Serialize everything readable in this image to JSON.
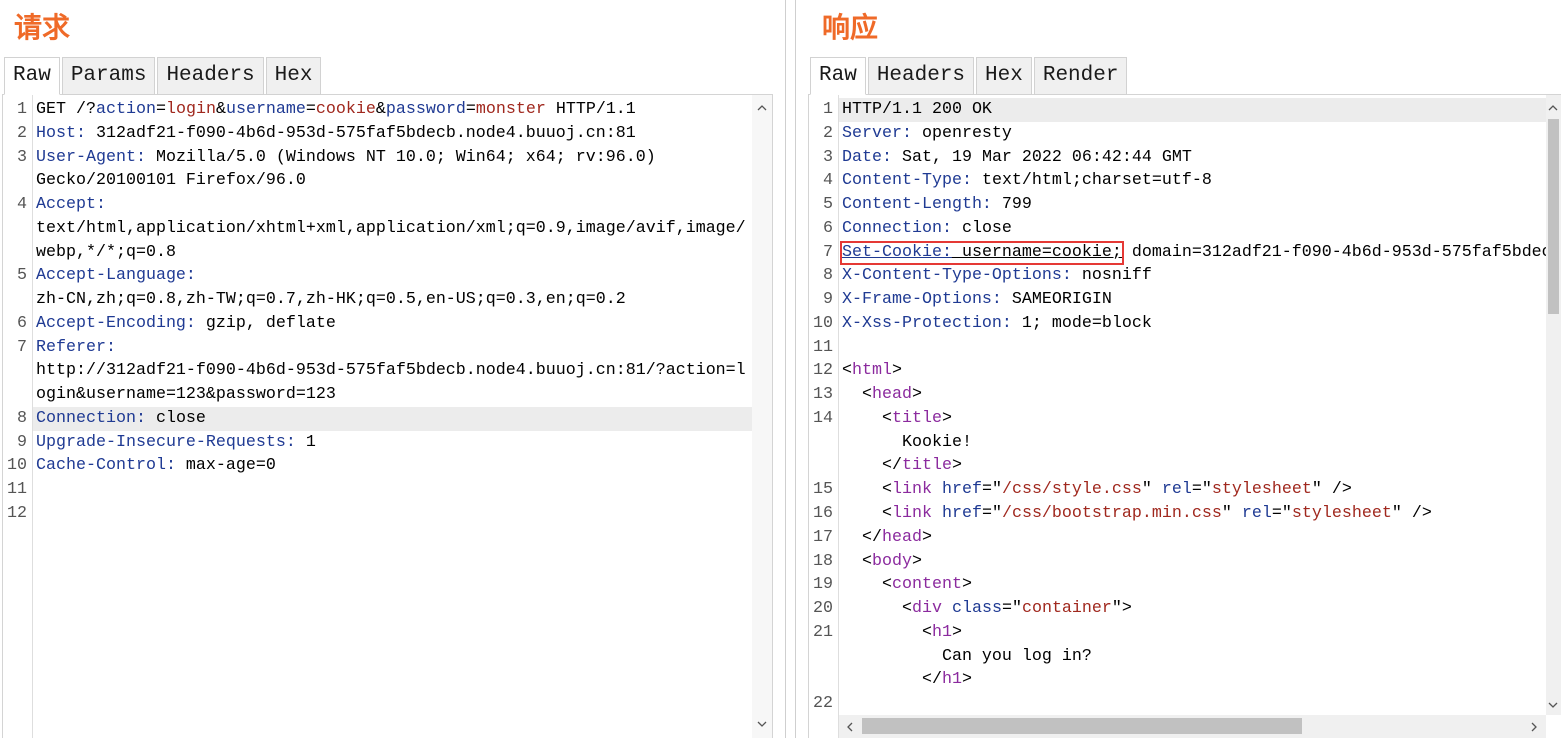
{
  "colors": {
    "accent": "#ef6a28",
    "plain": "#000000",
    "name": "#1f3a93",
    "value": "#a0281e",
    "tag": "#8b2a9e",
    "line_number": "#555555",
    "line_highlight": "#ececec",
    "highlight_box": "#e53935"
  },
  "icons": {
    "scroll_up": "chevron-up-icon",
    "scroll_down": "chevron-down-icon",
    "scroll_left": "chevron-left-icon",
    "scroll_right": "chevron-right-icon"
  },
  "request": {
    "title": "请求",
    "active_tab": "Raw",
    "tabs": [
      {
        "label": "Raw"
      },
      {
        "label": "Params"
      },
      {
        "label": "Headers"
      },
      {
        "label": "Hex"
      }
    ],
    "lines": [
      {
        "n": "1",
        "rows": [
          [
            [
              "GET /?",
              "plain"
            ],
            [
              "action",
              "name"
            ],
            [
              "=",
              "plain"
            ],
            [
              "login",
              "value"
            ],
            [
              "&",
              "plain"
            ],
            [
              "username",
              "name"
            ],
            [
              "=",
              "plain"
            ],
            [
              "cookie",
              "value"
            ],
            [
              "&",
              "plain"
            ],
            [
              "password",
              "name"
            ],
            [
              "=",
              "plain"
            ],
            [
              "monster",
              "value"
            ],
            [
              " HTTP/1.1",
              "plain"
            ]
          ]
        ]
      },
      {
        "n": "2",
        "rows": [
          [
            [
              "Host:",
              "name"
            ],
            [
              " 312adf21-f090-4b6d-953d-575faf5bdecb.node4.buuoj.cn:81",
              "plain"
            ]
          ]
        ]
      },
      {
        "n": "3",
        "rows": [
          [
            [
              "User-Agent:",
              "name"
            ],
            [
              " Mozilla/5.0 (Windows NT 10.0; Win64; x64; rv:96.0)",
              "plain"
            ]
          ],
          [
            [
              "Gecko/20100101 Firefox/96.0",
              "plain"
            ]
          ]
        ]
      },
      {
        "n": "4",
        "rows": [
          [
            [
              "Accept:",
              "name"
            ]
          ],
          [
            [
              "text/html,application/xhtml+xml,application/xml;q=0.9,image/avif,image/",
              "plain"
            ]
          ],
          [
            [
              "webp,*/*;q=0.8",
              "plain"
            ]
          ]
        ]
      },
      {
        "n": "5",
        "rows": [
          [
            [
              "Accept-Language:",
              "name"
            ]
          ],
          [
            [
              "zh-CN,zh;q=0.8,zh-TW;q=0.7,zh-HK;q=0.5,en-US;q=0.3,en;q=0.2",
              "plain"
            ]
          ]
        ]
      },
      {
        "n": "6",
        "rows": [
          [
            [
              "Accept-Encoding:",
              "name"
            ],
            [
              " gzip, deflate",
              "plain"
            ]
          ]
        ]
      },
      {
        "n": "7",
        "rows": [
          [
            [
              "Referer:",
              "name"
            ]
          ],
          [
            [
              "http://312adf21-f090-4b6d-953d-575faf5bdecb.node4.buuoj.cn:81/?action=l",
              "plain"
            ]
          ],
          [
            [
              "ogin&username=123&password=123",
              "plain"
            ]
          ]
        ]
      },
      {
        "n": "8",
        "highlight": true,
        "rows": [
          [
            [
              "Connection:",
              "name"
            ],
            [
              " close",
              "plain"
            ]
          ]
        ]
      },
      {
        "n": "9",
        "rows": [
          [
            [
              "Upgrade-Insecure-Requests:",
              "name"
            ],
            [
              " 1",
              "plain"
            ]
          ]
        ]
      },
      {
        "n": "10",
        "rows": [
          [
            [
              "Cache-Control:",
              "name"
            ],
            [
              " max-age=0",
              "plain"
            ]
          ]
        ]
      },
      {
        "n": "11",
        "rows": [
          []
        ]
      },
      {
        "n": "12",
        "rows": [
          []
        ]
      }
    ]
  },
  "response": {
    "title": "响应",
    "active_tab": "Raw",
    "tabs": [
      {
        "label": "Raw"
      },
      {
        "label": "Headers"
      },
      {
        "label": "Hex"
      },
      {
        "label": "Render"
      }
    ],
    "lines": [
      {
        "n": "1",
        "highlight": true,
        "rows": [
          [
            [
              "HTTP/1.1 200 OK",
              "plain"
            ]
          ]
        ]
      },
      {
        "n": "2",
        "rows": [
          [
            [
              "Server:",
              "name"
            ],
            [
              " openresty",
              "plain"
            ]
          ]
        ]
      },
      {
        "n": "3",
        "rows": [
          [
            [
              "Date:",
              "name"
            ],
            [
              " Sat, 19 Mar 2022 06:42:44 GMT",
              "plain"
            ]
          ]
        ]
      },
      {
        "n": "4",
        "rows": [
          [
            [
              "Content-Type:",
              "name"
            ],
            [
              " text/html;charset=utf-8",
              "plain"
            ]
          ]
        ]
      },
      {
        "n": "5",
        "rows": [
          [
            [
              "Content-Length:",
              "name"
            ],
            [
              " 799",
              "plain"
            ]
          ]
        ]
      },
      {
        "n": "6",
        "rows": [
          [
            [
              "Connection:",
              "name"
            ],
            [
              " close",
              "plain"
            ]
          ]
        ]
      },
      {
        "n": "7",
        "rows": [
          [
            [
              "Set-Cookie:",
              "name",
              "boxed"
            ],
            [
              " username=cookie;",
              "plain",
              "boxed"
            ],
            [
              " domain=312adf21-f090-4b6d-953d-575faf5bdec",
              "plain"
            ]
          ]
        ]
      },
      {
        "n": "8",
        "rows": [
          [
            [
              "X-Content-Type-Options:",
              "name"
            ],
            [
              " nosniff",
              "plain"
            ]
          ]
        ]
      },
      {
        "n": "9",
        "rows": [
          [
            [
              "X-Frame-Options:",
              "name"
            ],
            [
              " SAMEORIGIN",
              "plain"
            ]
          ]
        ]
      },
      {
        "n": "10",
        "rows": [
          [
            [
              "X-Xss-Protection:",
              "name"
            ],
            [
              " 1; mode=block",
              "plain"
            ]
          ]
        ]
      },
      {
        "n": "11",
        "rows": [
          []
        ]
      },
      {
        "n": "12",
        "rows": [
          [
            [
              "<",
              "plain"
            ],
            [
              "html",
              "tag"
            ],
            [
              ">",
              "plain"
            ]
          ]
        ]
      },
      {
        "n": "13",
        "rows": [
          [
            [
              "  <",
              "plain"
            ],
            [
              "head",
              "tag"
            ],
            [
              ">",
              "plain"
            ]
          ]
        ]
      },
      {
        "n": "14",
        "rows": [
          [
            [
              "    <",
              "plain"
            ],
            [
              "title",
              "tag"
            ],
            [
              ">",
              "plain"
            ]
          ],
          [
            [
              "      Kookie!",
              "plain"
            ]
          ],
          [
            [
              "    </",
              "plain"
            ],
            [
              "title",
              "tag"
            ],
            [
              ">",
              "plain"
            ]
          ]
        ]
      },
      {
        "n": "15",
        "rows": [
          [
            [
              "    <",
              "plain"
            ],
            [
              "link",
              "tag"
            ],
            [
              " ",
              "plain"
            ],
            [
              "href",
              "name"
            ],
            [
              "=\"",
              "plain"
            ],
            [
              "/css/style.css",
              "value"
            ],
            [
              "\" ",
              "plain"
            ],
            [
              "rel",
              "name"
            ],
            [
              "=\"",
              "plain"
            ],
            [
              "stylesheet",
              "value"
            ],
            [
              "\" />",
              "plain"
            ]
          ]
        ]
      },
      {
        "n": "16",
        "rows": [
          [
            [
              "    <",
              "plain"
            ],
            [
              "link",
              "tag"
            ],
            [
              " ",
              "plain"
            ],
            [
              "href",
              "name"
            ],
            [
              "=\"",
              "plain"
            ],
            [
              "/css/bootstrap.min.css",
              "value"
            ],
            [
              "\" ",
              "plain"
            ],
            [
              "rel",
              "name"
            ],
            [
              "=\"",
              "plain"
            ],
            [
              "stylesheet",
              "value"
            ],
            [
              "\" />",
              "plain"
            ]
          ]
        ]
      },
      {
        "n": "17",
        "rows": [
          [
            [
              "  </",
              "plain"
            ],
            [
              "head",
              "tag"
            ],
            [
              ">",
              "plain"
            ]
          ]
        ]
      },
      {
        "n": "18",
        "rows": [
          [
            [
              "  <",
              "plain"
            ],
            [
              "body",
              "tag"
            ],
            [
              ">",
              "plain"
            ]
          ]
        ]
      },
      {
        "n": "19",
        "rows": [
          [
            [
              "    <",
              "plain"
            ],
            [
              "content",
              "tag"
            ],
            [
              ">",
              "plain"
            ]
          ]
        ]
      },
      {
        "n": "20",
        "rows": [
          [
            [
              "      <",
              "plain"
            ],
            [
              "div",
              "tag"
            ],
            [
              " ",
              "plain"
            ],
            [
              "class",
              "name"
            ],
            [
              "=\"",
              "plain"
            ],
            [
              "container",
              "value"
            ],
            [
              "\">",
              "plain"
            ]
          ]
        ]
      },
      {
        "n": "21",
        "rows": [
          [
            [
              "        <",
              "plain"
            ],
            [
              "h1",
              "tag"
            ],
            [
              ">",
              "plain"
            ]
          ],
          [
            [
              "          Can you log in?",
              "plain"
            ]
          ],
          [
            [
              "        </",
              "plain"
            ],
            [
              "h1",
              "tag"
            ],
            [
              ">",
              "plain"
            ]
          ]
        ]
      },
      {
        "n": "22",
        "rows": [
          []
        ]
      }
    ]
  }
}
